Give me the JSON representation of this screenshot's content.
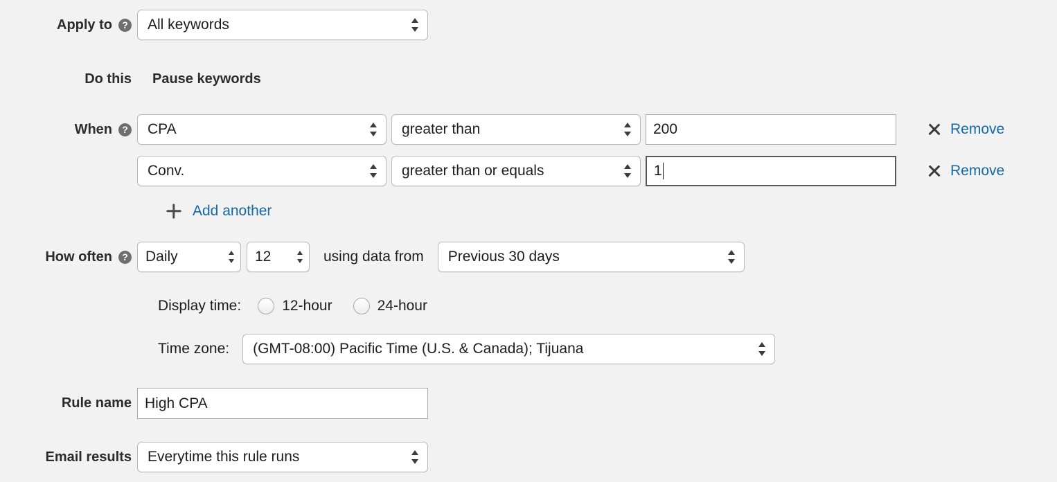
{
  "apply_to": {
    "label": "Apply to",
    "help_icon": "help-circle-icon",
    "select_value": "All keywords"
  },
  "do_this": {
    "label": "Do this",
    "action_text": "Pause keywords"
  },
  "when": {
    "label": "When",
    "help_icon": "help-circle-icon",
    "conditions": [
      {
        "metric": "CPA",
        "operator": "greater than",
        "value": "200",
        "focused": false,
        "remove_label": "Remove",
        "remove_icon": "close-x-icon"
      },
      {
        "metric": "Conv.",
        "operator": "greater than or equals",
        "value": "1",
        "focused": true,
        "remove_label": "Remove",
        "remove_icon": "close-x-icon"
      }
    ],
    "add_another_label": "Add another",
    "add_another_icon": "plus-icon"
  },
  "how_often": {
    "label": "How often",
    "help_icon": "help-circle-icon",
    "frequency_value": "Daily",
    "hour_value": "12",
    "using_data_from_label": "using data from",
    "date_range_value": "Previous 30 days"
  },
  "display_time": {
    "label": "Display time:",
    "options": [
      {
        "label": "12-hour",
        "selected": false
      },
      {
        "label": "24-hour",
        "selected": false
      }
    ]
  },
  "time_zone": {
    "label": "Time zone:",
    "select_value": "(GMT-08:00) Pacific Time (U.S. & Canada); Tijuana"
  },
  "rule_name": {
    "label": "Rule name",
    "value": "High CPA"
  },
  "email_results": {
    "label": "Email results",
    "select_value": "Everytime this rule runs"
  },
  "colors": {
    "page_background": "#f2f2f2",
    "link": "#1568a5",
    "label_text": "#2b2b2b",
    "field_border": "#b9b9b9",
    "input_border": "#a8a8a8",
    "focus_border": "#585858",
    "help_icon_background": "#6e6e6e"
  }
}
